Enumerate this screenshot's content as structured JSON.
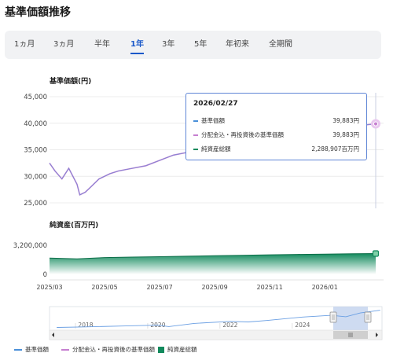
{
  "page": {
    "title": "基準価額推移"
  },
  "tabs": [
    {
      "label": "1ヵ月",
      "active": false
    },
    {
      "label": "3ヵ月",
      "active": false
    },
    {
      "label": "半年",
      "active": false
    },
    {
      "label": "1年",
      "active": true
    },
    {
      "label": "3年",
      "active": false
    },
    {
      "label": "5年",
      "active": false
    },
    {
      "label": "年初来",
      "active": false
    },
    {
      "label": "全期間",
      "active": false
    }
  ],
  "colors": {
    "nav": "#4a90d9",
    "reinvested": "#c67fd0",
    "assets": "#128a5d",
    "accent": "#1a58c9"
  },
  "tooltip": {
    "date": "2026/02/27",
    "rows": [
      {
        "label": "基準価額",
        "value": "39,883円"
      },
      {
        "label": "分配金込・再投資後の基準価額",
        "value": "39,883円"
      },
      {
        "label": "純資産総額",
        "value": "2,288,907百万円"
      }
    ]
  },
  "legend": [
    {
      "label": "基準価額"
    },
    {
      "label": "分配金込・再投資後の基準価額"
    },
    {
      "label": "純資産総額"
    }
  ],
  "chart_data": [
    {
      "type": "line",
      "title": "基準価額(円)",
      "ylim": [
        25000,
        45000
      ],
      "y_ticks": [
        "45,000",
        "40,000",
        "35,000",
        "30,000",
        "25,000"
      ],
      "y_tick_values": [
        45000,
        40000,
        35000,
        30000,
        25000
      ],
      "grid": true,
      "x": [
        0,
        0.2,
        0.45,
        0.7,
        1.0,
        1.1,
        1.3,
        1.5,
        1.8,
        2.2,
        2.5,
        3.0,
        3.5,
        4.0,
        4.5,
        5.0,
        5.5,
        6.0,
        6.5,
        7.0,
        7.5,
        8.0,
        8.5,
        9.0,
        9.5,
        10.0,
        10.5,
        11.0,
        11.5,
        11.85
      ],
      "series": [
        {
          "name": "基準価額",
          "values": [
            32500,
            31000,
            29500,
            31500,
            28500,
            26500,
            27000,
            28000,
            29500,
            30500,
            31000,
            31500,
            32000,
            33000,
            34000,
            34500,
            35000,
            35500,
            36000,
            36500,
            37000,
            37200,
            37600,
            38000,
            38300,
            38700,
            39100,
            39400,
            39700,
            39883
          ]
        },
        {
          "name": "分配金込・再投資後の基準価額",
          "values": [
            32500,
            31000,
            29500,
            31500,
            28500,
            26500,
            27000,
            28000,
            29500,
            30500,
            31000,
            31500,
            32000,
            33000,
            34000,
            34500,
            35000,
            35500,
            36000,
            36500,
            37000,
            37200,
            37600,
            38000,
            38300,
            38700,
            39100,
            39400,
            39700,
            39883
          ]
        }
      ]
    },
    {
      "type": "area",
      "title": "純資産(百万円)",
      "ylim": [
        0,
        3200000
      ],
      "y_ticks": [
        "3,200,000",
        "0"
      ],
      "y_tick_values": [
        3200000,
        0
      ],
      "x_ticks": [
        "2025/03",
        "2025/05",
        "2025/07",
        "2025/09",
        "2025/11",
        "2026/01"
      ],
      "x_tick_positions": [
        0,
        2,
        4,
        6,
        8,
        10
      ],
      "x": [
        0,
        1,
        2,
        3,
        4,
        5,
        6,
        7,
        8,
        9,
        10,
        11,
        11.85
      ],
      "series": [
        {
          "name": "純資産総額",
          "values": [
            1800000,
            1700000,
            1850000,
            1900000,
            1950000,
            2000000,
            2050000,
            2100000,
            2150000,
            2200000,
            2230000,
            2270000,
            2288907
          ]
        }
      ]
    },
    {
      "type": "line",
      "x_ticks": [
        "2018",
        "2020",
        "2022",
        "2024"
      ],
      "x_tick_positions": [
        2018,
        2020,
        2022,
        2024
      ],
      "xlim": [
        2017,
        2026.2
      ],
      "x": [
        2017.2,
        2018,
        2019,
        2020,
        2020.3,
        2021,
        2022,
        2022.5,
        2023,
        2024,
        2024.8,
        2025.2,
        2025.6,
        2026.15
      ],
      "series": [
        {
          "name": "基準価額",
          "values": [
            10000,
            11000,
            12500,
            14000,
            11500,
            17000,
            20500,
            19500,
            22000,
            28000,
            31000,
            28500,
            35000,
            39883
          ]
        }
      ],
      "ylim": [
        8000,
        42000
      ]
    }
  ]
}
